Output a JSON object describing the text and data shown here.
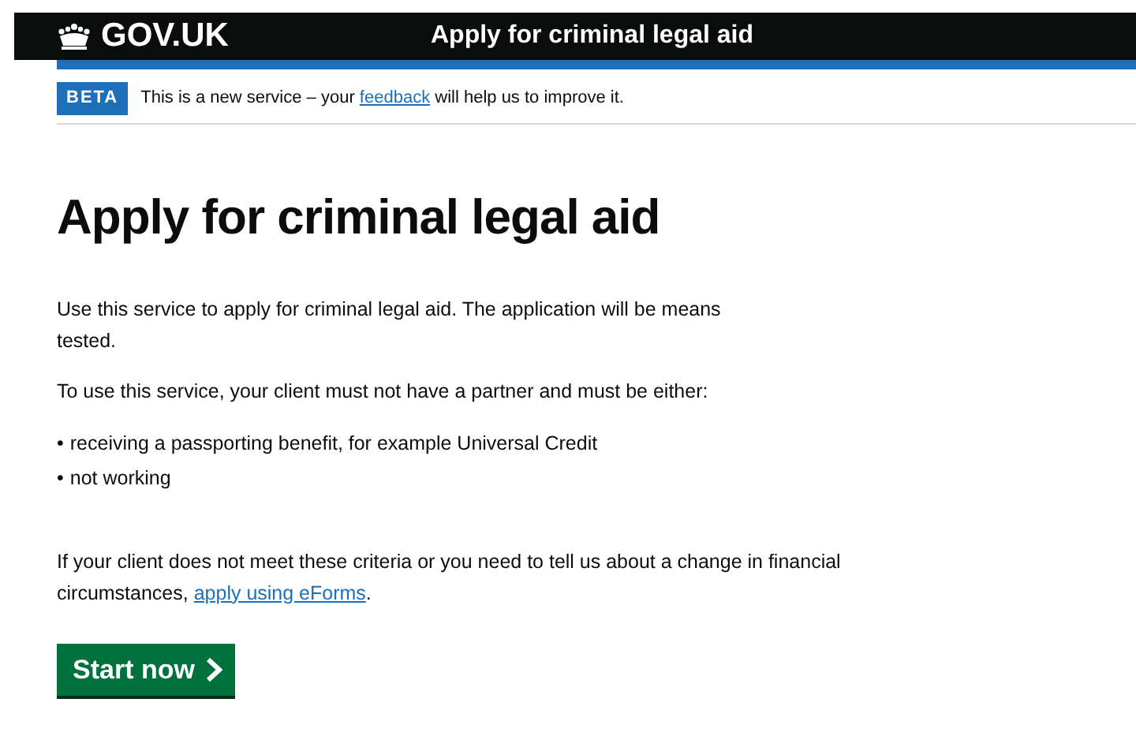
{
  "header": {
    "logo": "GOV.UK",
    "service_name": "Apply for criminal legal aid"
  },
  "phase_banner": {
    "tag": "BETA",
    "before": "This is a new service – your",
    "link": "feedback",
    "after": "will help us to improve it."
  },
  "heading": "Apply for criminal legal aid",
  "intro": [
    "Use this service to apply for criminal legal aid. The application will be means tested.",
    "To use this service, your client must not have a partner and must be either:"
  ],
  "list": {
    "marker": "•",
    "items": [
      "receiving a passporting benefit, for example Universal Credit",
      "not working"
    ]
  },
  "eforms": {
    "before": "If your client does not meet these criteria or you need to tell us about a change in financial circumstances,",
    "link": "apply using eForms",
    "after": "."
  },
  "start_button": "Start now"
}
